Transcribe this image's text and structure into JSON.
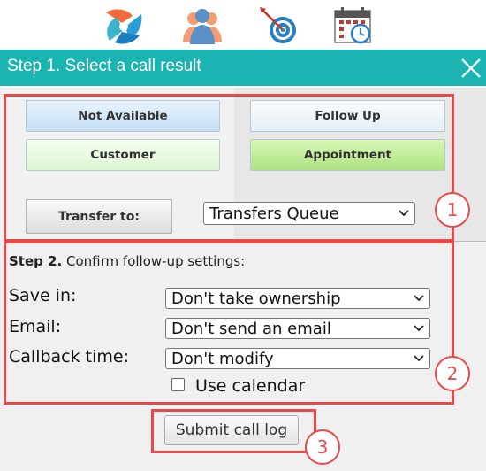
{
  "toolbar": {
    "icons": [
      "crm-logo-icon",
      "contacts-icon",
      "target-icon",
      "calendar-icon"
    ]
  },
  "step1": {
    "title": "Step 1. Select a call result",
    "buttons": {
      "not_available": "Not Available",
      "follow_up": "Follow Up",
      "customer": "Customer",
      "appointment": "Appointment"
    },
    "transfer_label": "Transfer to:",
    "transfer_select": "Transfers Queue"
  },
  "step2": {
    "title_bold": "Step 2.",
    "title_rest": " Confirm follow-up settings:",
    "save_in_label": "Save in:",
    "save_in_value": "Don't take ownership",
    "email_label": "Email:",
    "email_value": "Don't send an email",
    "callback_label": "Callback time:",
    "callback_value": "Don't modify",
    "use_calendar_label": "Use calendar"
  },
  "submit_label": "Submit call log",
  "annotations": {
    "one": "1",
    "two": "2",
    "three": "3"
  },
  "colors": {
    "header": "#1bb4b2",
    "annotation": "#e84949",
    "appointment": "#ade282"
  }
}
